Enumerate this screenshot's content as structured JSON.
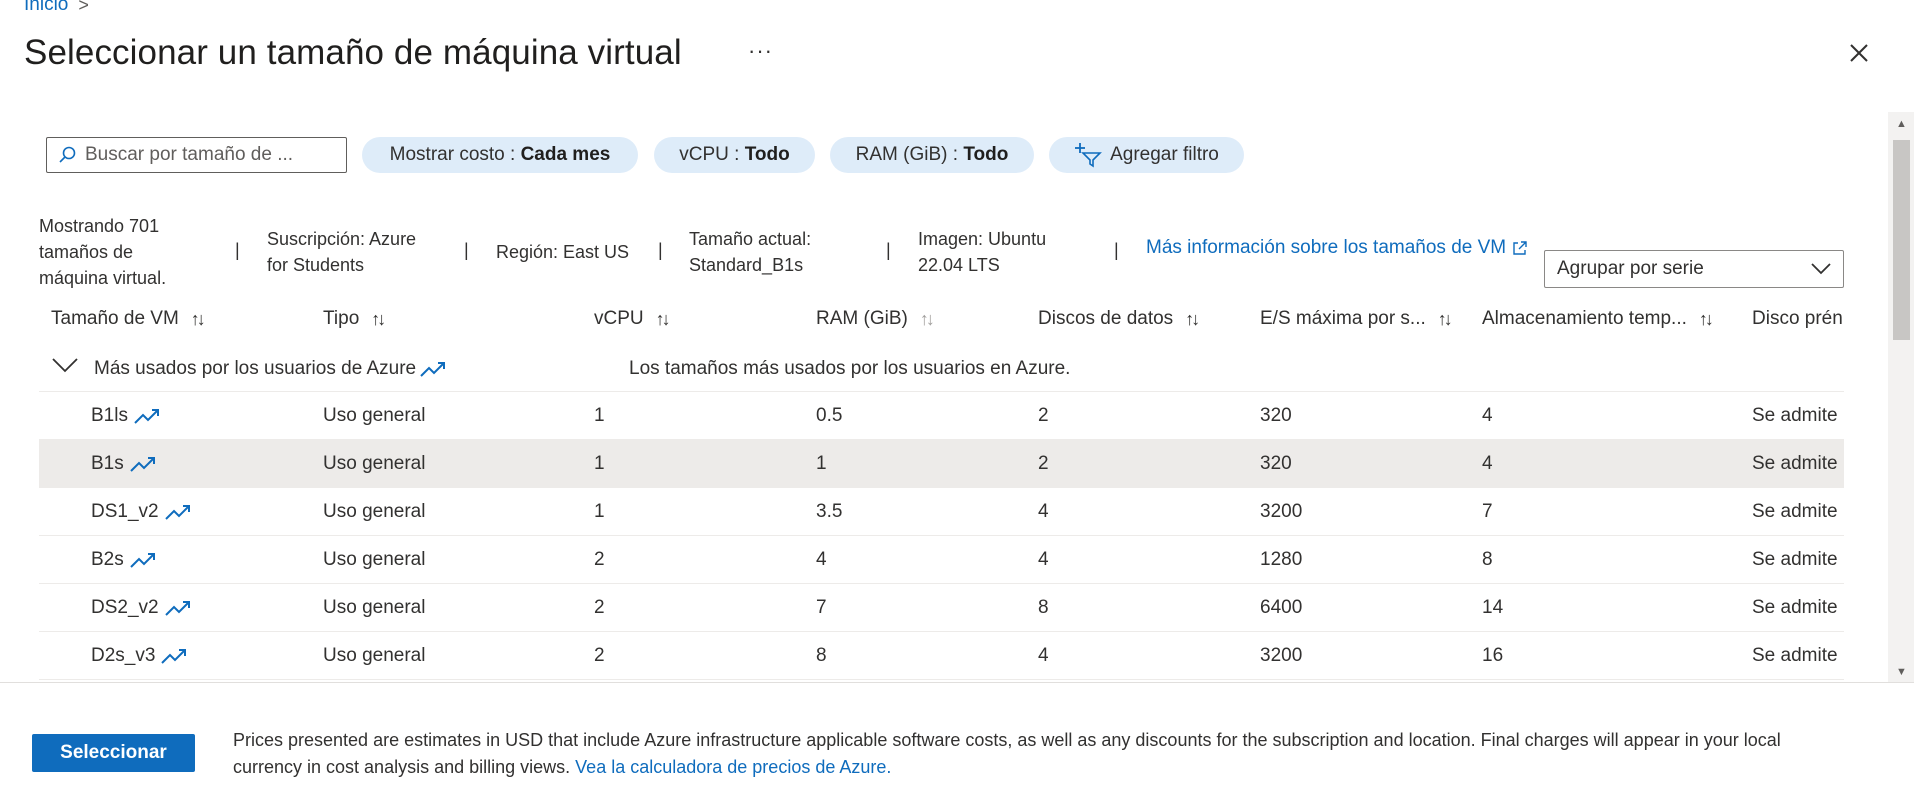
{
  "breadcrumb": {
    "home": "Inicio",
    "separator": ">"
  },
  "title": "Seleccionar un tamaño de máquina virtual",
  "more": "···",
  "search": {
    "placeholder": "Buscar por tamaño de ..."
  },
  "filters": [
    {
      "label": "Mostrar costo : ",
      "value": "Cada mes"
    },
    {
      "label": "vCPU : ",
      "value": "Todo"
    },
    {
      "label": "RAM (GiB) : ",
      "value": "Todo"
    },
    {
      "label": "Agregar filtro",
      "value": ""
    }
  ],
  "info": {
    "showing": "Mostrando 701 tamaños de máquina virtual.",
    "subscription": "Suscripción: Azure for Students",
    "region": "Región: East US",
    "current_size": "Tamaño actual: Standard_B1s",
    "image": "Imagen: Ubuntu 22.04 LTS",
    "separator": "|",
    "link": "Más información sobre los tamaños de VM"
  },
  "group_by": "Agrupar por serie",
  "table": {
    "columns": [
      "Tamaño de VM",
      "Tipo",
      "vCPU",
      "RAM (GiB)",
      "Discos de datos",
      "E/S máxima por s...",
      "Almacenamiento temp...",
      "Disco prén"
    ],
    "group": {
      "title": "Más usados por los usuarios de Azure",
      "description": "Los tamaños más usados por los usuarios en Azure."
    },
    "rows": [
      {
        "size": "B1ls",
        "type": "Uso general",
        "vcpu": "1",
        "ram": "0.5",
        "disks": "2",
        "iops": "320",
        "temp": "4",
        "premium": "Se admite",
        "selected": false
      },
      {
        "size": "B1s",
        "type": "Uso general",
        "vcpu": "1",
        "ram": "1",
        "disks": "2",
        "iops": "320",
        "temp": "4",
        "premium": "Se admite",
        "selected": true
      },
      {
        "size": "DS1_v2",
        "type": "Uso general",
        "vcpu": "1",
        "ram": "3.5",
        "disks": "4",
        "iops": "3200",
        "temp": "7",
        "premium": "Se admite",
        "selected": false
      },
      {
        "size": "B2s",
        "type": "Uso general",
        "vcpu": "2",
        "ram": "4",
        "disks": "4",
        "iops": "1280",
        "temp": "8",
        "premium": "Se admite",
        "selected": false
      },
      {
        "size": "DS2_v2",
        "type": "Uso general",
        "vcpu": "2",
        "ram": "7",
        "disks": "8",
        "iops": "6400",
        "temp": "14",
        "premium": "Se admite",
        "selected": false
      },
      {
        "size": "D2s_v3",
        "type": "Uso general",
        "vcpu": "2",
        "ram": "8",
        "disks": "4",
        "iops": "3200",
        "temp": "16",
        "premium": "Se admite",
        "selected": false
      }
    ]
  },
  "footer": {
    "select_button": "Seleccionar",
    "disclaimer": "Prices presented are estimates in USD that include Azure infrastructure applicable software costs, as well as any discounts for the subscription and location. Final charges will appear in your local currency in cost analysis and billing views.",
    "calculator_link": "Vea la calculadora de precios de Azure."
  },
  "colors": {
    "accent": "#0f6cbd",
    "pill_bg": "#deecf9",
    "selected_row": "#edebe9"
  }
}
